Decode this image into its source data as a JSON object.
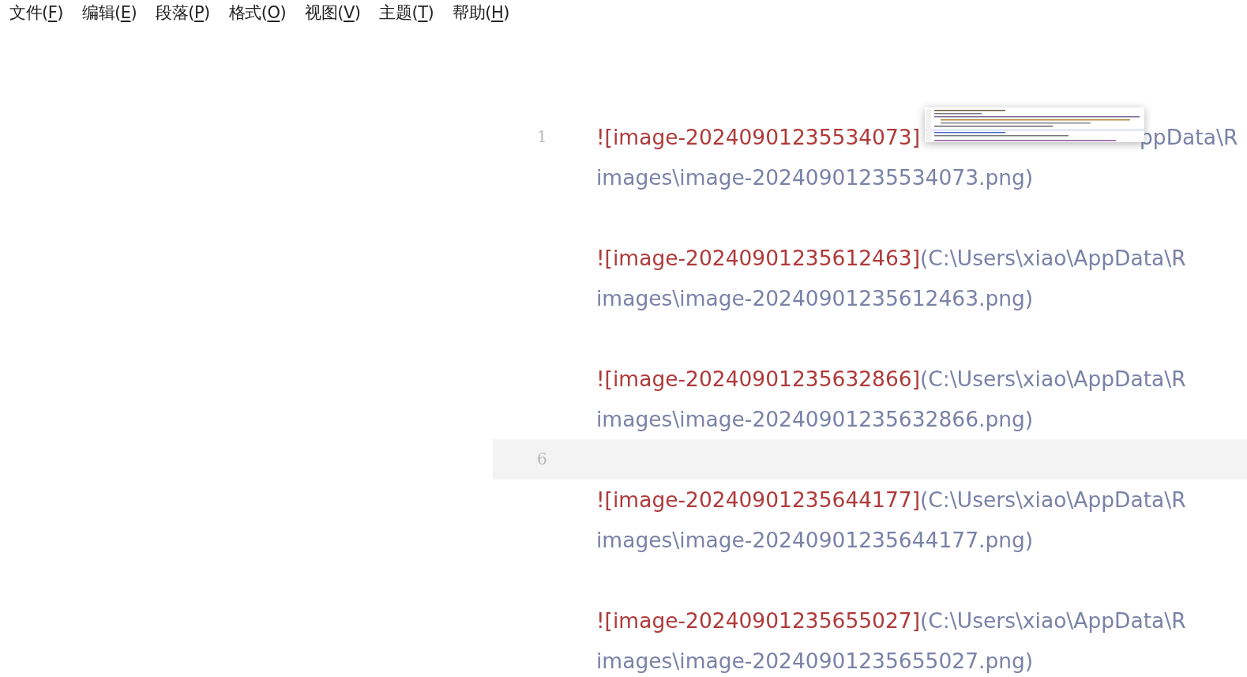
{
  "menu": [
    {
      "before": "文件(",
      "accelerator": "F",
      "after": ")"
    },
    {
      "before": "编辑(",
      "accelerator": "E",
      "after": ")"
    },
    {
      "before": "段落(",
      "accelerator": "P",
      "after": ")"
    },
    {
      "before": "格式(",
      "accelerator": "O",
      "after": ")"
    },
    {
      "before": "视图(",
      "accelerator": "V",
      "after": ")"
    },
    {
      "before": "主题(",
      "accelerator": "T",
      "after": ")"
    },
    {
      "before": "帮助(",
      "accelerator": "H",
      "after": ")"
    }
  ],
  "editor": {
    "rows": [
      {
        "kind": "text",
        "number": "1",
        "selected": false,
        "lines": [
          [
            {
              "kind": "alt",
              "text": "![image-20240901235534073]"
            },
            {
              "kind": "preview"
            },
            {
              "kind": "path",
              "text": "ppData\\R"
            }
          ],
          [
            {
              "kind": "path",
              "text": "images\\image-20240901235534073.png)"
            }
          ]
        ]
      },
      {
        "kind": "blank",
        "selected": false
      },
      {
        "kind": "text",
        "selected": false,
        "lines": [
          [
            {
              "kind": "alt",
              "text": "![image-20240901235612463]"
            },
            {
              "kind": "path",
              "text": "(C:\\Users\\xiao\\AppData\\R"
            }
          ],
          [
            {
              "kind": "path",
              "text": "images\\image-20240901235612463.png)"
            }
          ]
        ]
      },
      {
        "kind": "blank",
        "selected": false
      },
      {
        "kind": "text",
        "selected": false,
        "lines": [
          [
            {
              "kind": "alt",
              "text": "![image-20240901235632866]"
            },
            {
              "kind": "path",
              "text": "(C:\\Users\\xiao\\AppData\\R"
            }
          ],
          [
            {
              "kind": "path",
              "text": "images\\image-20240901235632866.png)"
            }
          ]
        ]
      },
      {
        "kind": "blank",
        "number": "6",
        "selected": true
      },
      {
        "kind": "text",
        "selected": false,
        "lines": [
          [
            {
              "kind": "alt",
              "text": "![image-20240901235644177]"
            },
            {
              "kind": "path",
              "text": "(C:\\Users\\xiao\\AppData\\R"
            }
          ],
          [
            {
              "kind": "path",
              "text": "images\\image-20240901235644177.png)"
            }
          ]
        ]
      },
      {
        "kind": "blank",
        "selected": false
      },
      {
        "kind": "text",
        "selected": false,
        "lines": [
          [
            {
              "kind": "alt",
              "text": "![image-20240901235655027]"
            },
            {
              "kind": "path",
              "text": "(C:\\Users\\xiao\\AppData\\R"
            }
          ],
          [
            {
              "kind": "path",
              "text": "images\\image-20240901235655027.png)"
            }
          ]
        ]
      }
    ]
  }
}
